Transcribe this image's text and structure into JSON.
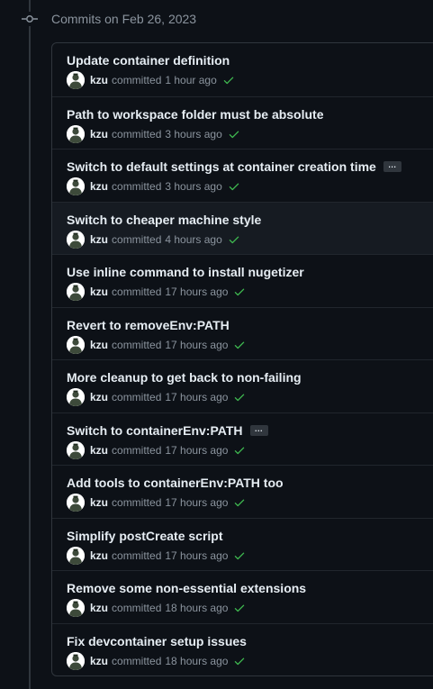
{
  "group": {
    "title": "Commits on Feb 26, 2023"
  },
  "commits": [
    {
      "title": "Update container definition",
      "author": "kzu",
      "action": "committed",
      "time": "1 hour ago",
      "truncated": false
    },
    {
      "title": "Path to workspace folder must be absolute",
      "author": "kzu",
      "action": "committed",
      "time": "3 hours ago",
      "truncated": false
    },
    {
      "title": "Switch to default settings at container creation time",
      "author": "kzu",
      "action": "committed",
      "time": "3 hours ago",
      "truncated": true
    },
    {
      "title": "Switch to cheaper machine style",
      "author": "kzu",
      "action": "committed",
      "time": "4 hours ago",
      "truncated": false
    },
    {
      "title": "Use inline command to install nugetizer",
      "author": "kzu",
      "action": "committed",
      "time": "17 hours ago",
      "truncated": false
    },
    {
      "title": "Revert to removeEnv:PATH",
      "author": "kzu",
      "action": "committed",
      "time": "17 hours ago",
      "truncated": false
    },
    {
      "title": "More cleanup to get back to non-failing",
      "author": "kzu",
      "action": "committed",
      "time": "17 hours ago",
      "truncated": false
    },
    {
      "title": "Switch to containerEnv:PATH",
      "author": "kzu",
      "action": "committed",
      "time": "17 hours ago",
      "truncated": true
    },
    {
      "title": "Add tools to containerEnv:PATH too",
      "author": "kzu",
      "action": "committed",
      "time": "17 hours ago",
      "truncated": false
    },
    {
      "title": "Simplify postCreate script",
      "author": "kzu",
      "action": "committed",
      "time": "17 hours ago",
      "truncated": false
    },
    {
      "title": "Remove some non-essential extensions",
      "author": "kzu",
      "action": "committed",
      "time": "18 hours ago",
      "truncated": false
    },
    {
      "title": "Fix devcontainer setup issues",
      "author": "kzu",
      "action": "committed",
      "time": "18 hours ago",
      "truncated": false
    }
  ],
  "ellipsis_label": "...",
  "colors": {
    "background": "#0d1117",
    "border": "#30363d",
    "muted_text": "#8b949e",
    "primary_text": "#e6edf3",
    "success_check": "#3fb950",
    "hover_row": "#161b22"
  },
  "icons": {
    "timeline": "git-commit-icon",
    "status": "check-icon",
    "avatar": "user-avatar"
  }
}
